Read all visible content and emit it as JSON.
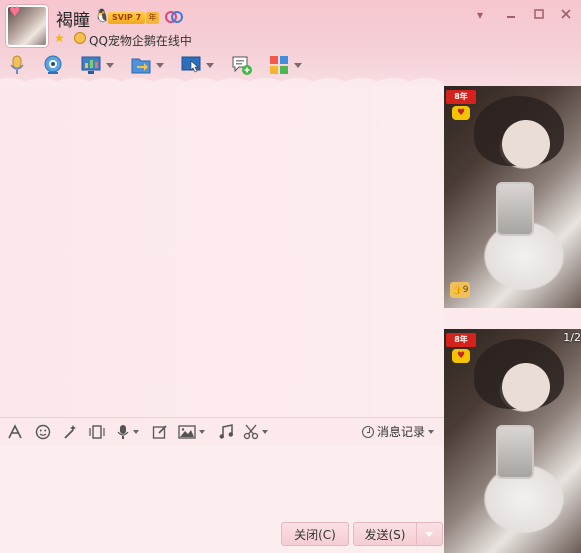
{
  "profile": {
    "nickname": "褐瞳",
    "vip_badge": "SVIP 7",
    "year_badge": "年",
    "pet_status": "QQ宠物企鹅在线中",
    "icons": [
      "qq-penguin-icon",
      "star-icon",
      "pet-penguin-icon",
      "couple-link-icon"
    ]
  },
  "window_controls": [
    "dropdown-icon",
    "minimize-icon",
    "maximize-icon",
    "close-icon"
  ],
  "toolbar": {
    "items": [
      {
        "name": "voice-call-button",
        "icon": "microphone-icon"
      },
      {
        "name": "video-call-button",
        "icon": "camera-icon"
      },
      {
        "name": "remote-desktop-button",
        "icon": "monitor-chart-icon"
      },
      {
        "name": "send-file-button",
        "icon": "folder-arrow-icon"
      },
      {
        "name": "screen-share-button",
        "icon": "screen-cursor-icon"
      },
      {
        "name": "discussion-group-button",
        "icon": "chat-add-icon"
      },
      {
        "name": "apps-button",
        "icon": "apps-grid-icon"
      }
    ]
  },
  "input_toolbar": {
    "items": [
      "font-icon",
      "emoji-icon",
      "magic-icon",
      "screen-shake-icon",
      "voice-message-icon",
      "edit-icon",
      "image-icon",
      "music-icon",
      "scissors-icon"
    ],
    "history_label": "消息记录"
  },
  "buttons": {
    "close_label": "关闭(C)",
    "send_label": "发送(S)"
  },
  "side_panel": {
    "badge_text": "8年",
    "page_indicator": "1/2",
    "thumb_count": "9"
  },
  "colors": {
    "header_pink": "#f7c6cf",
    "chat_bg": "#fbe8ea",
    "button_bg": "#f8d6dc",
    "badge_red": "#d6221c"
  }
}
